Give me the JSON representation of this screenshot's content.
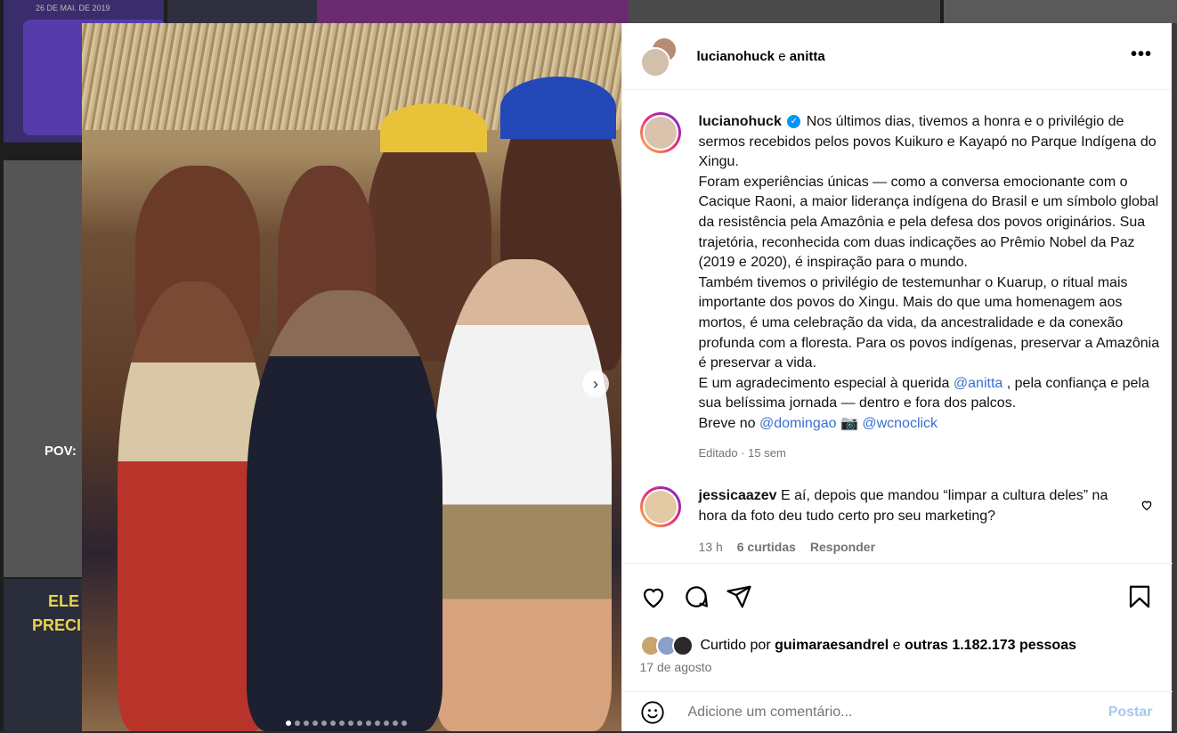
{
  "background": {
    "date_stamp": "26 DE MAI. DE 2019",
    "overlay_texts": [
      "POV:",
      "ELE N",
      "PRECIS"
    ]
  },
  "post": {
    "header": {
      "author1": "lucianohuck",
      "connector": "e",
      "author2": "anitta"
    },
    "more_label": "•••",
    "photo": {
      "next_label": "›",
      "slide_count": 14
    },
    "caption": {
      "username": "lucianohuck",
      "lines": [
        "Nos últimos dias, tivemos a honra e o privilégio de sermos recebidos pelos povos Kuikuro e Kayapó no Parque Indígena do Xingu.",
        "Foram experiências únicas — como a conversa emocionante com o Cacique Raoni, a maior liderança indígena do Brasil e um símbolo global da resistência pela Amazônia e pela defesa dos povos originários. Sua trajetória, reconhecida com duas indicações ao Prêmio Nobel da Paz (2019 e 2020), é inspiração para o mundo.",
        "Também tivemos o privilégio de testemunhar o Kuarup, o ritual mais importante dos povos do Xingu. Mais do que uma homenagem aos mortos, é uma celebração da vida, da ancestralidade e da conexão profunda com a floresta. Para os povos indígenas, preservar a Amazônia é preservar a vida."
      ],
      "thanks_prefix": "E um agradecimento especial à querida",
      "thanks_mention": "@anitta",
      "thanks_suffix": ", pela confiança e pela sua belíssima jornada — dentro e fora dos palcos.",
      "breve_prefix": "Breve no",
      "mention_domingao": "@domingao",
      "camera_emoji": "📷",
      "mention_wcnoclick": "@wcnoclick",
      "meta": "Editado · 15 sem"
    },
    "comment": {
      "username": "jessicaazev",
      "text": "E aí, depois que mandou “limpar a cultura deles” na hora da foto deu tudo certo pro seu marketing?",
      "time": "13 h",
      "likes": "6 curtidas",
      "reply": "Responder"
    },
    "likes": {
      "prefix": "Curtido por",
      "user": "guimaraesandrel",
      "middle": "e",
      "others": "outras 1.182.173 pessoas"
    },
    "date": "17 de agosto",
    "add_comment": {
      "placeholder": "Adicione um comentário...",
      "post_label": "Postar"
    }
  },
  "colors": {
    "accent": "#0095f6",
    "mention": "#3a6fd0",
    "muted": "#737373"
  }
}
